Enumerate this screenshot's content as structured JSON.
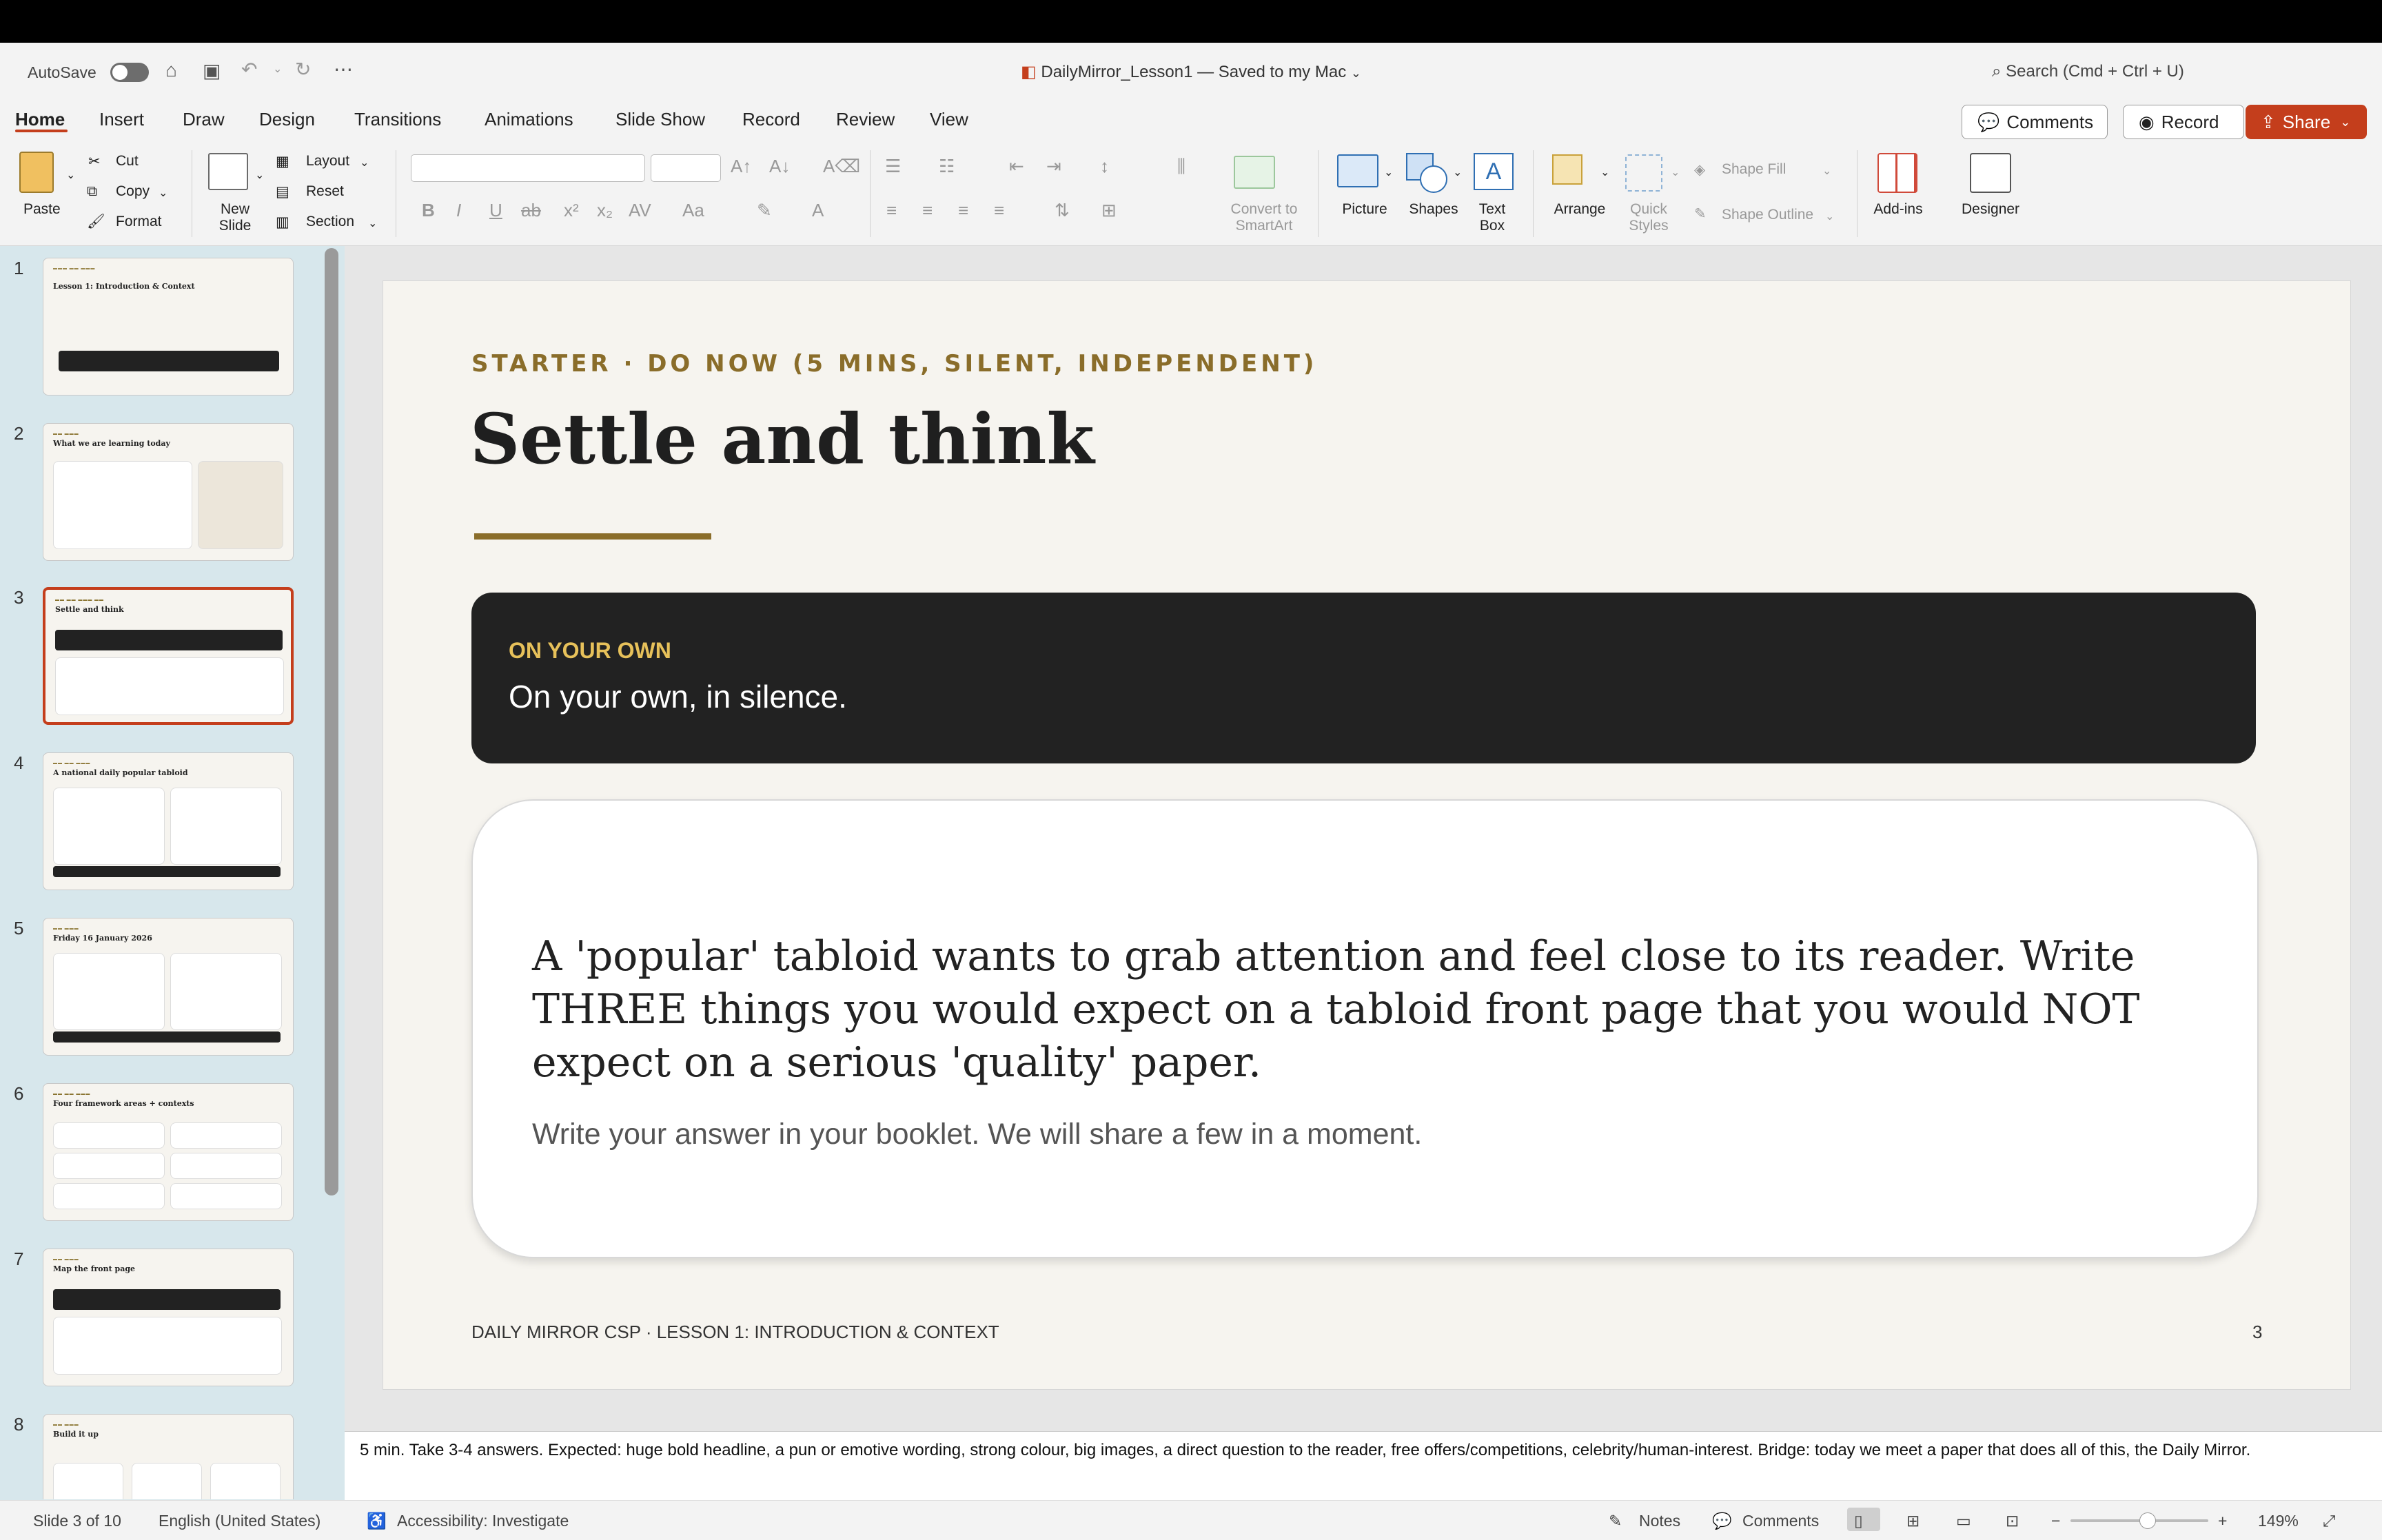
{
  "window": {
    "autosave_label": "AutoSave",
    "doc_title": "DailyMirror_Lesson1 — Saved to my Mac",
    "search_placeholder": "Search (Cmd + Ctrl + U)"
  },
  "tabs": [
    {
      "label": "Home",
      "active": true
    },
    {
      "label": "Insert"
    },
    {
      "label": "Draw"
    },
    {
      "label": "Design"
    },
    {
      "label": "Transitions"
    },
    {
      "label": "Animations"
    },
    {
      "label": "Slide Show"
    },
    {
      "label": "Record"
    },
    {
      "label": "Review"
    },
    {
      "label": "View"
    }
  ],
  "top_actions": {
    "comments": "Comments",
    "record": "Record",
    "share": "Share"
  },
  "ribbon": {
    "paste": "Paste",
    "cut": "Cut",
    "copy": "Copy",
    "format": "Format",
    "new_slide": "New Slide",
    "layout": "Layout",
    "reset": "Reset",
    "section": "Section",
    "convert_smartart": "Convert to SmartArt",
    "picture": "Picture",
    "shapes": "Shapes",
    "text_box": "Text Box",
    "arrange": "Arrange",
    "quick_styles": "Quick Styles",
    "shape_fill": "Shape Fill",
    "shape_outline": "Shape Outline",
    "add_ins": "Add-ins",
    "designer": "Designer"
  },
  "thumbnails": [
    {
      "num": "1",
      "title": "Lesson 1: Introduction & Context"
    },
    {
      "num": "2",
      "title": "What we are learning today"
    },
    {
      "num": "3",
      "title": "Settle and think",
      "selected": true
    },
    {
      "num": "4",
      "title": "A national daily popular tabloid"
    },
    {
      "num": "5",
      "title": "Friday 16 January 2026"
    },
    {
      "num": "6",
      "title": "Four framework areas + contexts"
    },
    {
      "num": "7",
      "title": "Map the front page"
    },
    {
      "num": "8",
      "title": "Build it up"
    }
  ],
  "slide": {
    "kicker": "STARTER · DO NOW (5 MINS, SILENT, INDEPENDENT)",
    "title": "Settle and think",
    "bar_label": "ON YOUR OWN",
    "bar_text": "On your own, in silence.",
    "card_main": "A 'popular' tabloid wants to grab attention and feel close to its reader. Write THREE things you would expect on a tabloid front page that you would NOT expect on a serious 'quality' paper.",
    "card_sub": "Write your answer in your booklet. We will share a few in a moment.",
    "footer": "DAILY MIRROR CSP  ·  LESSON 1: INTRODUCTION & CONTEXT",
    "number": "3"
  },
  "notes": "5 min. Take 3-4 answers. Expected: huge bold headline, a pun or emotive wording, strong colour, big images, a direct question to the reader, free offers/competitions, celebrity/human-interest. Bridge: today we meet a paper that does all of this, the Daily Mirror.",
  "status": {
    "slide": "Slide 3 of 10",
    "language": "English (United States)",
    "accessibility": "Accessibility: Investigate",
    "notes": "Notes",
    "comments": "Comments",
    "zoom": "149%"
  },
  "colors": {
    "accent": "#c43e1c",
    "gold": "#8a6d2a",
    "dark": "#222222",
    "thumb_panel": "#d7e7ec"
  }
}
